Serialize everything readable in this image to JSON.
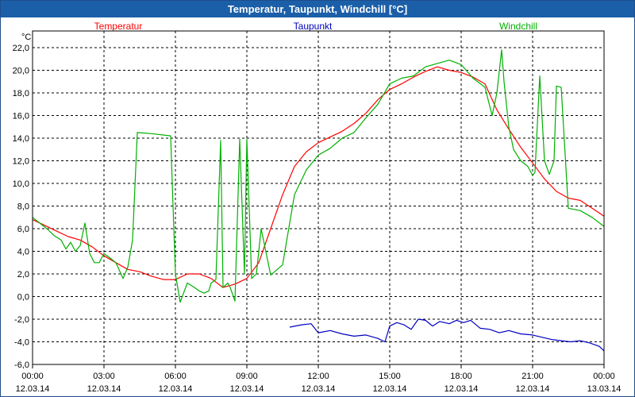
{
  "window": {
    "title": "Temperatur, Taupunkt, Windchill [°C]"
  },
  "chart_data": {
    "type": "line",
    "title": "Temperatur, Taupunkt, Windchill [°C]",
    "ylabel": "°C",
    "xlabel": "",
    "ylim": [
      -6,
      23
    ],
    "xlim": [
      0,
      24
    ],
    "grid": true,
    "legend_position": "top",
    "y_ticks": [
      "-6,0",
      "-4,0",
      "-2,0",
      "0,0",
      "2,0",
      "4,0",
      "6,0",
      "8,0",
      "10,0",
      "12,0",
      "14,0",
      "16,0",
      "18,0",
      "20,0",
      "22,0"
    ],
    "x_ticks": [
      {
        "time": "00:00",
        "date": "12.03.14"
      },
      {
        "time": "03:00",
        "date": "12.03.14"
      },
      {
        "time": "06:00",
        "date": "12.03.14"
      },
      {
        "time": "09:00",
        "date": "12.03.14"
      },
      {
        "time": "12:00",
        "date": "12.03.14"
      },
      {
        "time": "15:00",
        "date": "12.03.14"
      },
      {
        "time": "18:00",
        "date": "12.03.14"
      },
      {
        "time": "21:00",
        "date": "12.03.14"
      },
      {
        "time": "00:00",
        "date": "13.03.14"
      }
    ],
    "series": [
      {
        "name": "Temperatur",
        "color": "#ff0000",
        "x": [
          0,
          0.5,
          1,
          1.5,
          2,
          2.5,
          3,
          3.5,
          4,
          4.5,
          5,
          5.5,
          6,
          6.5,
          7,
          7.5,
          8,
          8.5,
          9,
          9.5,
          10,
          10.5,
          11,
          11.5,
          12,
          12.5,
          13,
          13.5,
          14,
          14.5,
          15,
          15.5,
          16,
          16.5,
          17,
          17.5,
          18,
          18.5,
          19,
          19.5,
          20,
          20.5,
          21,
          21.5,
          22,
          22.5,
          23,
          23.5,
          24
        ],
        "y": [
          6.8,
          6.3,
          5.8,
          5.3,
          5.0,
          4.4,
          3.6,
          3.0,
          2.4,
          2.2,
          1.8,
          1.5,
          1.5,
          2.0,
          2.0,
          1.6,
          0.8,
          1.1,
          1.6,
          3.0,
          6.0,
          9.0,
          11.5,
          12.8,
          13.6,
          14.1,
          14.6,
          15.3,
          16.2,
          17.4,
          18.3,
          18.8,
          19.4,
          19.9,
          20.3,
          20.0,
          19.8,
          19.4,
          18.8,
          16.5,
          14.8,
          13.2,
          11.8,
          10.4,
          9.3,
          8.7,
          8.5,
          7.8,
          7.1
        ]
      },
      {
        "name": "Taupunkt",
        "color": "#0000c0",
        "x": [
          10.8,
          11.3,
          11.7,
          12.0,
          12.5,
          13.0,
          13.5,
          14.0,
          14.5,
          14.8,
          15.0,
          15.3,
          15.6,
          15.9,
          16.2,
          16.5,
          16.8,
          17.1,
          17.5,
          17.8,
          18.1,
          18.4,
          18.8,
          19.2,
          19.6,
          20.0,
          20.5,
          21.0,
          21.4,
          21.8,
          22.2,
          22.6,
          23.0,
          23.4,
          23.8,
          24.0
        ],
        "y": [
          -2.7,
          -2.5,
          -2.4,
          -3.2,
          -3.0,
          -3.3,
          -3.5,
          -3.4,
          -3.7,
          -4.0,
          -2.6,
          -2.3,
          -2.5,
          -2.9,
          -2.0,
          -2.1,
          -2.6,
          -2.2,
          -2.4,
          -2.1,
          -2.3,
          -2.1,
          -2.8,
          -2.9,
          -3.2,
          -3.0,
          -3.3,
          -3.4,
          -3.6,
          -3.8,
          -3.9,
          -4.0,
          -3.9,
          -4.1,
          -4.4,
          -4.8
        ]
      },
      {
        "name": "Windchill",
        "color": "#00b000",
        "x": [
          0,
          0.3,
          0.6,
          0.9,
          1.2,
          1.4,
          1.6,
          1.8,
          2.0,
          2.2,
          2.4,
          2.6,
          2.8,
          3.0,
          3.2,
          3.5,
          3.8,
          4.0,
          4.2,
          4.4,
          5.0,
          5.8,
          5.9,
          6.0,
          6.2,
          6.5,
          6.8,
          7.0,
          7.2,
          7.4,
          7.5,
          7.7,
          7.9,
          8.0,
          8.2,
          8.3,
          8.5,
          8.7,
          8.9,
          9.0,
          9.2,
          9.4,
          9.6,
          10.0,
          10.5,
          11.0,
          11.5,
          12.0,
          12.5,
          13.0,
          13.5,
          14.0,
          14.5,
          15.0,
          15.5,
          16.0,
          16.5,
          17.0,
          17.5,
          18.0,
          18.5,
          19.0,
          19.3,
          19.5,
          19.7,
          19.8,
          19.9,
          20.0,
          20.2,
          20.5,
          20.8,
          21.0,
          21.1,
          21.3,
          21.5,
          21.7,
          21.9,
          22.0,
          22.2,
          22.5,
          23.0,
          23.5,
          24.0
        ],
        "y": [
          7.0,
          6.5,
          6.0,
          5.4,
          5.0,
          4.2,
          4.8,
          4.0,
          4.5,
          6.5,
          3.8,
          3.0,
          3.0,
          3.8,
          3.5,
          3.0,
          1.6,
          2.6,
          5.0,
          14.5,
          14.4,
          14.2,
          8.0,
          2.0,
          -0.5,
          1.2,
          0.8,
          0.5,
          0.3,
          0.5,
          1.2,
          1.5,
          13.8,
          0.8,
          1.2,
          0.8,
          -0.4,
          13.9,
          2.0,
          13.9,
          1.6,
          2.0,
          6.0,
          1.9,
          2.8,
          9.0,
          11.2,
          12.5,
          13.1,
          14.0,
          14.5,
          15.8,
          17.0,
          18.8,
          19.3,
          19.5,
          20.3,
          20.6,
          20.9,
          20.5,
          19.3,
          18.5,
          16.0,
          18.0,
          21.8,
          19.0,
          17.0,
          15.0,
          13.0,
          12.0,
          11.5,
          10.7,
          11.0,
          19.5,
          12.0,
          10.8,
          12.0,
          18.6,
          18.5,
          7.8,
          7.6,
          7.0,
          6.2
        ]
      }
    ]
  }
}
